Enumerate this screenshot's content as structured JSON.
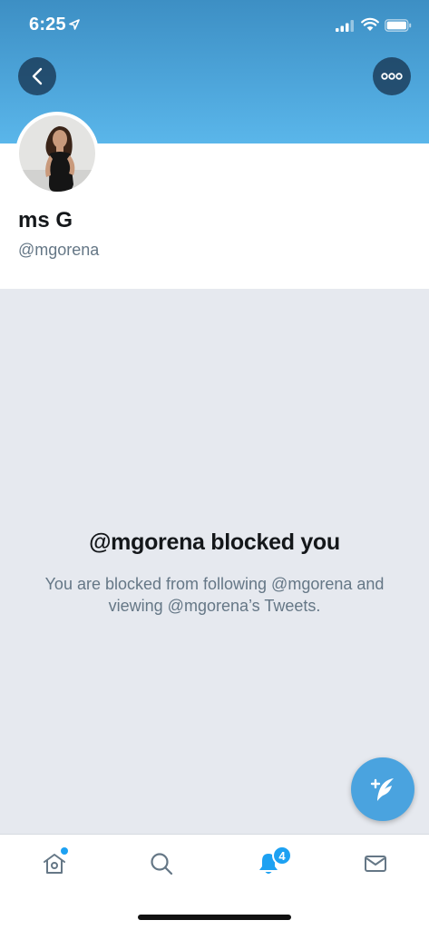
{
  "status_bar": {
    "time": "6:25",
    "icons": [
      "location-arrow-icon",
      "cellular-signal-icon",
      "wifi-icon",
      "battery-icon"
    ]
  },
  "header": {
    "back_icon": "chevron-left-icon",
    "more_icon": "more-options-icon"
  },
  "profile": {
    "display_name": "ms G",
    "handle": "@mgorena"
  },
  "blocked": {
    "title": "@mgorena blocked you",
    "description": "You are blocked from following @mgorena and viewing @mgorena’s Tweets."
  },
  "compose": {
    "icon": "compose-tweet-icon"
  },
  "tab_bar": {
    "tabs": [
      {
        "name": "home",
        "icon": "home-icon",
        "active": false,
        "dot": true
      },
      {
        "name": "search",
        "icon": "search-icon",
        "active": false
      },
      {
        "name": "notifications",
        "icon": "bell-icon",
        "active": true,
        "badge": "4"
      },
      {
        "name": "messages",
        "icon": "envelope-icon",
        "active": false
      }
    ]
  },
  "colors": {
    "accent": "#1da1f2",
    "header_gradient_top": "#3d8fc4",
    "header_gradient_bottom": "#5ab6ea",
    "blocked_background": "#e6e9ef",
    "muted_text": "#657786"
  }
}
